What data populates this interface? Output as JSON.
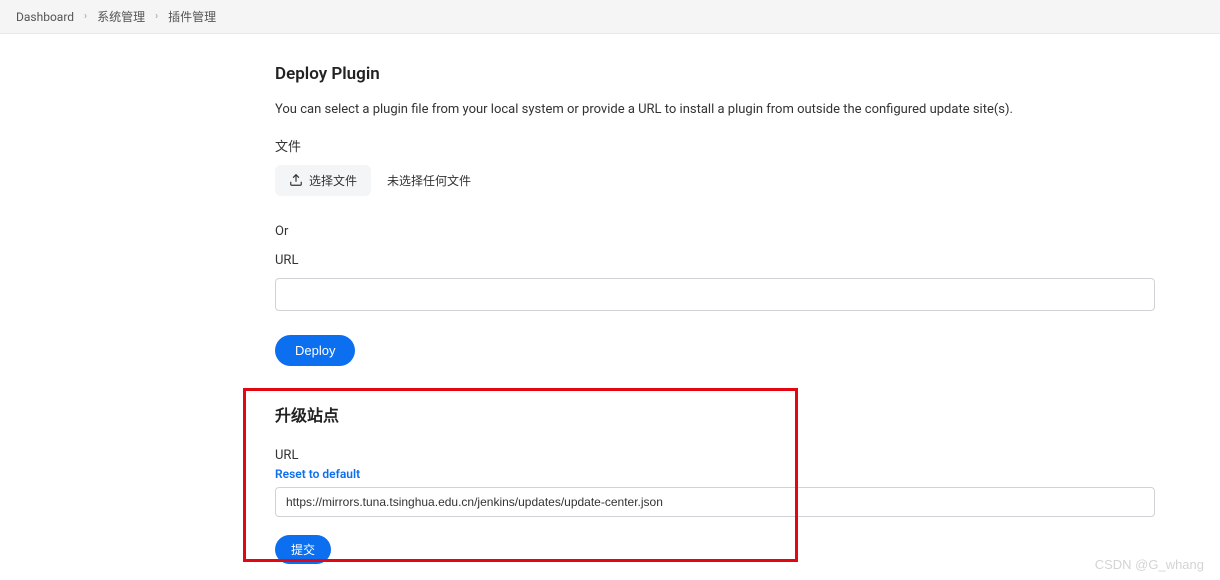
{
  "breadcrumb": {
    "items": [
      "Dashboard",
      "系统管理",
      "插件管理"
    ]
  },
  "deploy": {
    "title": "Deploy Plugin",
    "description": "You can select a plugin file from your local system or provide a URL to install a plugin from outside the configured update site(s).",
    "file_label": "文件",
    "choose_file_label": "选择文件",
    "no_file_text": "未选择任何文件",
    "or_text": "Or",
    "url_label": "URL",
    "url_value": "",
    "deploy_button": "Deploy"
  },
  "upgrade": {
    "title": "升级站点",
    "url_label": "URL",
    "reset_link": "Reset to default",
    "url_value": "https://mirrors.tuna.tsinghua.edu.cn/jenkins/updates/update-center.json",
    "submit_button": "提交"
  },
  "watermark": "CSDN @G_whang"
}
